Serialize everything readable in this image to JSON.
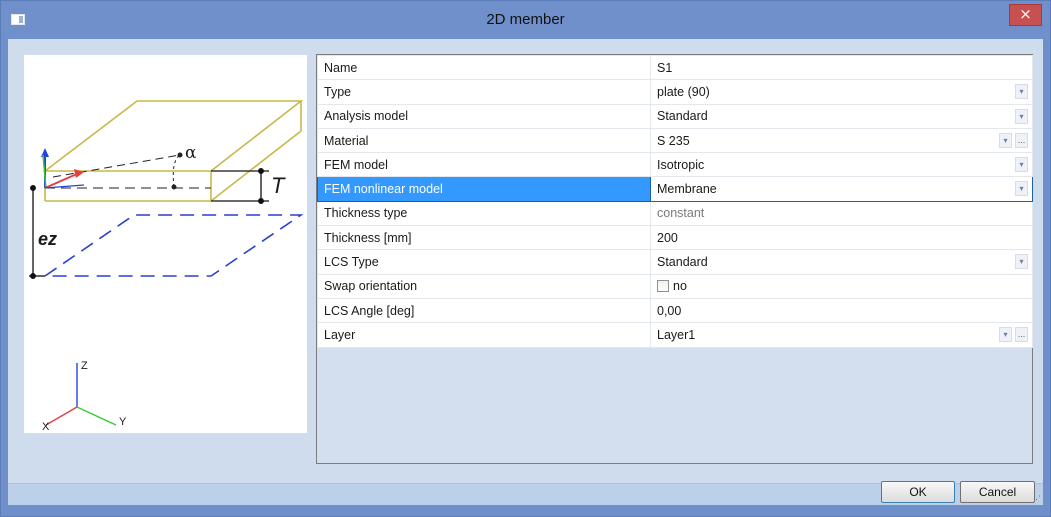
{
  "window": {
    "title": "2D member",
    "close_glyph": "×"
  },
  "preview": {
    "labels": {
      "alpha": "α",
      "thickness": "T",
      "eccentricity": "ez"
    },
    "axes": {
      "x": "X",
      "y": "Y",
      "z": "Z"
    },
    "colors": {
      "plate_outline": "#c8b84a",
      "membrane_outline": "#2a3fcf",
      "axis_x": "#e04040",
      "axis_y": "#33cc33",
      "axis_z": "#2244dd"
    }
  },
  "properties": {
    "rows": [
      {
        "name": "Name",
        "value": "S1"
      },
      {
        "name": "Type",
        "value": "plate (90)"
      },
      {
        "name": "Analysis model",
        "value": "Standard"
      },
      {
        "name": "Material",
        "value": "S 235"
      },
      {
        "name": "FEM model",
        "value": "Isotropic"
      },
      {
        "name": "FEM nonlinear model",
        "value": "Membrane"
      },
      {
        "name": "Thickness type",
        "value": "constant"
      },
      {
        "name": "Thickness [mm]",
        "value": "200"
      },
      {
        "name": "LCS Type",
        "value": "Standard"
      },
      {
        "name": "Swap orientation",
        "value": "no"
      },
      {
        "name": "LCS Angle [deg]",
        "value": "0,00"
      },
      {
        "name": "Layer",
        "value": "Layer1"
      }
    ],
    "dropdown_glyph": "▾",
    "ellipsis_glyph": "..."
  },
  "buttons": {
    "ok": "OK",
    "cancel": "Cancel"
  },
  "selection_color": "#3399ff"
}
